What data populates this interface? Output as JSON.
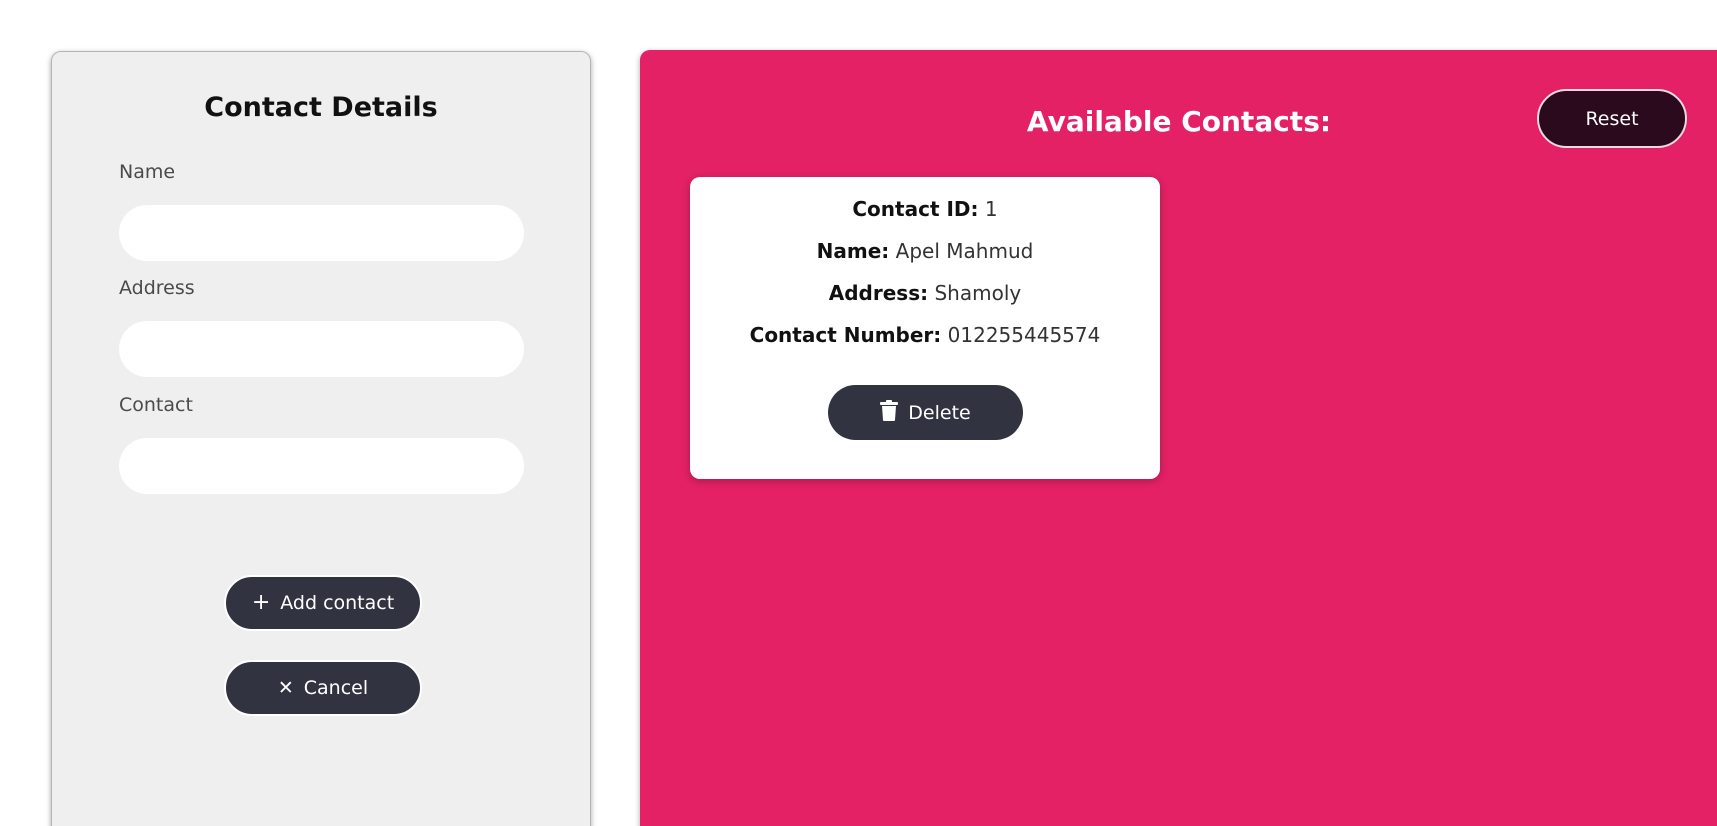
{
  "form": {
    "title": "Contact Details",
    "fields": [
      {
        "label": "Name",
        "value": "",
        "placeholder": ""
      },
      {
        "label": "Address",
        "value": "",
        "placeholder": ""
      },
      {
        "label": "Contact",
        "value": "",
        "placeholder": ""
      }
    ],
    "add_label": "Add contact",
    "add_icon": "plus-icon",
    "cancel_label": "Cancel",
    "cancel_icon": "close-icon",
    "background_color": "#efefef",
    "button_color": "#313440"
  },
  "contacts_panel": {
    "title": "Available Contacts:",
    "reset_label": "Reset",
    "background_color": "#e32164",
    "cards": [
      {
        "id_label": "Contact ID:",
        "id_value": "1",
        "name_label": "Name:",
        "name_value": "Apel Mahmud",
        "address_label": "Address:",
        "address_value": "Shamoly",
        "number_label": "Contact Number:",
        "number_value": "012255445574",
        "delete_label": "Delete",
        "delete_icon": "trash-icon"
      }
    ]
  }
}
